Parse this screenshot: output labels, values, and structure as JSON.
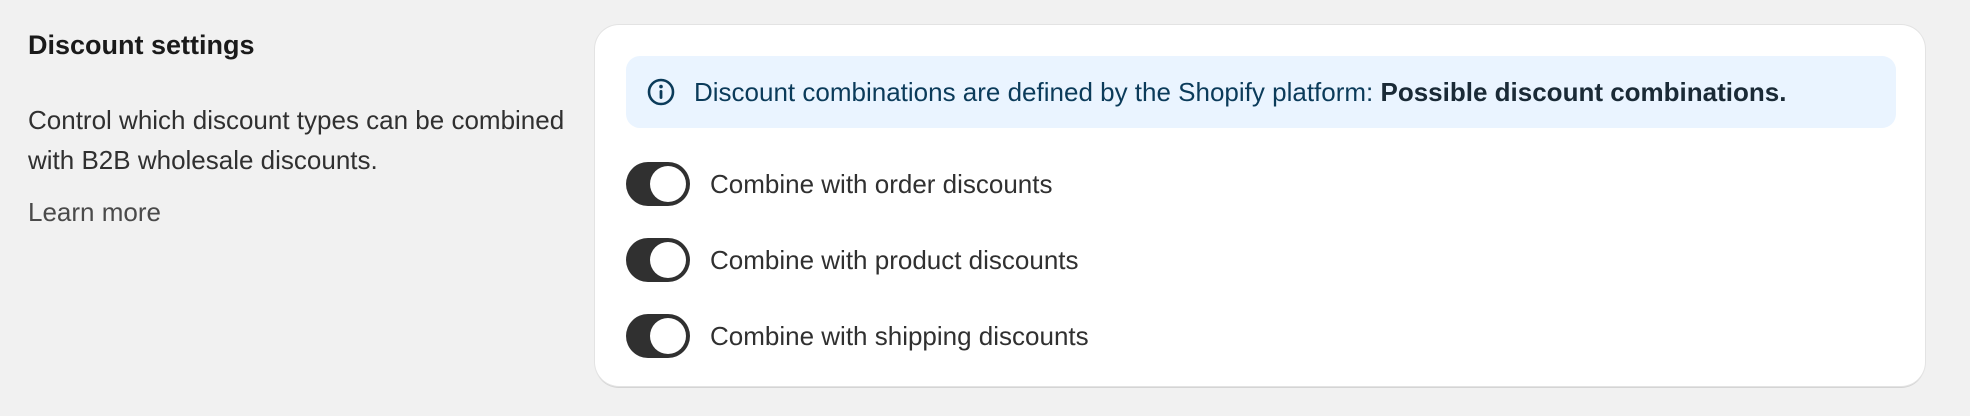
{
  "section": {
    "title": "Discount settings",
    "description": "Control which discount types can be combined with B2B wholesale discounts.",
    "learn_more": "Learn more"
  },
  "banner": {
    "icon": "info-icon",
    "text": "Discount combinations are defined by the Shopify platform: ",
    "link": "Possible discount combinations."
  },
  "toggles": [
    {
      "label": "Combine with order discounts",
      "checked": true
    },
    {
      "label": "Combine with product discounts",
      "checked": true
    },
    {
      "label": "Combine with shipping discounts",
      "checked": true
    }
  ],
  "colors": {
    "page_bg": "#f1f1f1",
    "banner_bg": "#eaf4ff",
    "toggle_on": "#303030",
    "banner_text": "#0b3b5a"
  }
}
